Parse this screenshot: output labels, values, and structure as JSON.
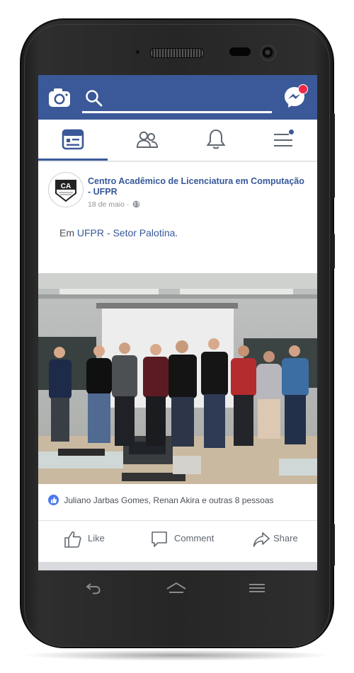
{
  "colors": {
    "brand": "#3b5998",
    "link": "#365899",
    "badge": "#f02849",
    "like": "#4a78f0"
  },
  "topbar": {
    "icons": [
      "camera-icon",
      "search-icon",
      "messenger-icon"
    ]
  },
  "navbar": {
    "items": [
      "news-feed-icon",
      "friends-icon",
      "notifications-icon",
      "menu-icon"
    ]
  },
  "post": {
    "page_name": "Centro Acadêmico de Licenciatura em Computação - UFPR",
    "avatar_text": "CA",
    "date": "18 de maio",
    "meta_separator": "·",
    "checkin_prefix": "Em",
    "checkin_place": "UFPR - Setor Palotina.",
    "reactions_text": "Juliano Jarbas Gomes, Renan Akira e outras 8 pessoas",
    "actions": {
      "like": "Like",
      "comment": "Comment",
      "share": "Share"
    }
  },
  "system_nav": [
    "back-icon",
    "home-icon",
    "recents-icon"
  ]
}
